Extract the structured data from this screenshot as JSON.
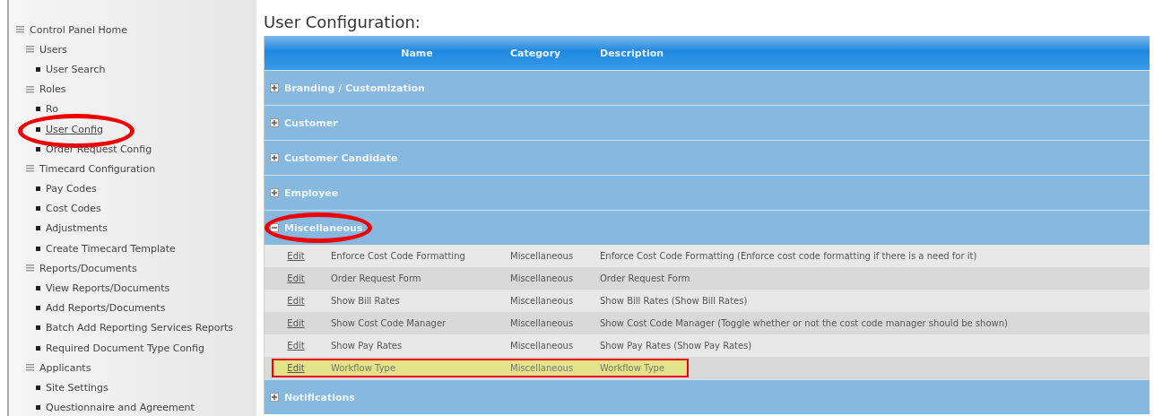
{
  "sidebar": {
    "tree": [
      {
        "label": "Control Panel Home",
        "kind": "group",
        "children": [
          {
            "label": "Users",
            "kind": "group",
            "children": [
              {
                "label": "User Search",
                "kind": "leaf"
              }
            ]
          },
          {
            "label": "Roles",
            "kind": "group",
            "children": [
              {
                "label": "Ro",
                "kind": "leaf"
              },
              {
                "label": "User Config",
                "kind": "leaf",
                "link": true,
                "circled": true
              },
              {
                "label": "Order Request Config",
                "kind": "leaf"
              }
            ]
          },
          {
            "label": "Timecard Configuration",
            "kind": "group",
            "children": [
              {
                "label": "Pay Codes",
                "kind": "leaf"
              },
              {
                "label": "Cost Codes",
                "kind": "leaf"
              },
              {
                "label": "Adjustments",
                "kind": "leaf"
              },
              {
                "label": "Create Timecard Template",
                "kind": "leaf"
              }
            ]
          },
          {
            "label": "Reports/Documents",
            "kind": "group",
            "children": [
              {
                "label": "View Reports/Documents",
                "kind": "leaf"
              },
              {
                "label": "Add Reports/Documents",
                "kind": "leaf"
              },
              {
                "label": "Batch Add Reporting Services Reports",
                "kind": "leaf"
              },
              {
                "label": "Required Document Type Config",
                "kind": "leaf"
              }
            ]
          },
          {
            "label": "Applicants",
            "kind": "group",
            "children": [
              {
                "label": "Site Settings",
                "kind": "leaf"
              },
              {
                "label": "Questionnaire and Agreement",
                "kind": "leaf"
              }
            ]
          }
        ]
      }
    ]
  },
  "page_title": "User Configuration:",
  "table": {
    "columns": [
      "Name",
      "Category",
      "Description"
    ],
    "groups": [
      {
        "label": "Branding / Customization",
        "expanded": false,
        "circled": false
      },
      {
        "label": "Customer",
        "expanded": false,
        "circled": false
      },
      {
        "label": "Customer Candidate",
        "expanded": false,
        "circled": false
      },
      {
        "label": "Employee",
        "expanded": false,
        "circled": false
      },
      {
        "label": "Miscellaneous",
        "expanded": true,
        "circled": true,
        "rows": [
          {
            "action": "Edit",
            "name": "Enforce Cost Code Formatting",
            "category": "Miscellaneous",
            "description": "Enforce Cost Code Formatting (Enforce cost code formatting if there is a need for it)",
            "selected": false
          },
          {
            "action": "Edit",
            "name": "Order Request Form",
            "category": "Miscellaneous",
            "description": "Order Request Form",
            "selected": false
          },
          {
            "action": "Edit",
            "name": "Show Bill Rates",
            "category": "Miscellaneous",
            "description": "Show Bill Rates (Show Bill Rates)",
            "selected": false
          },
          {
            "action": "Edit",
            "name": "Show Cost Code Manager",
            "category": "Miscellaneous",
            "description": "Show Cost Code Manager (Toggle whether or not the cost code manager should be shown)",
            "selected": false
          },
          {
            "action": "Edit",
            "name": "Show Pay Rates",
            "category": "Miscellaneous",
            "description": "Show Pay Rates (Show Pay Rates)",
            "selected": false
          },
          {
            "action": "Edit",
            "name": "Workflow Type",
            "category": "Miscellaneous",
            "description": "Workflow Type",
            "selected": true
          }
        ]
      },
      {
        "label": "Notifications",
        "expanded": false,
        "circled": false
      }
    ]
  }
}
